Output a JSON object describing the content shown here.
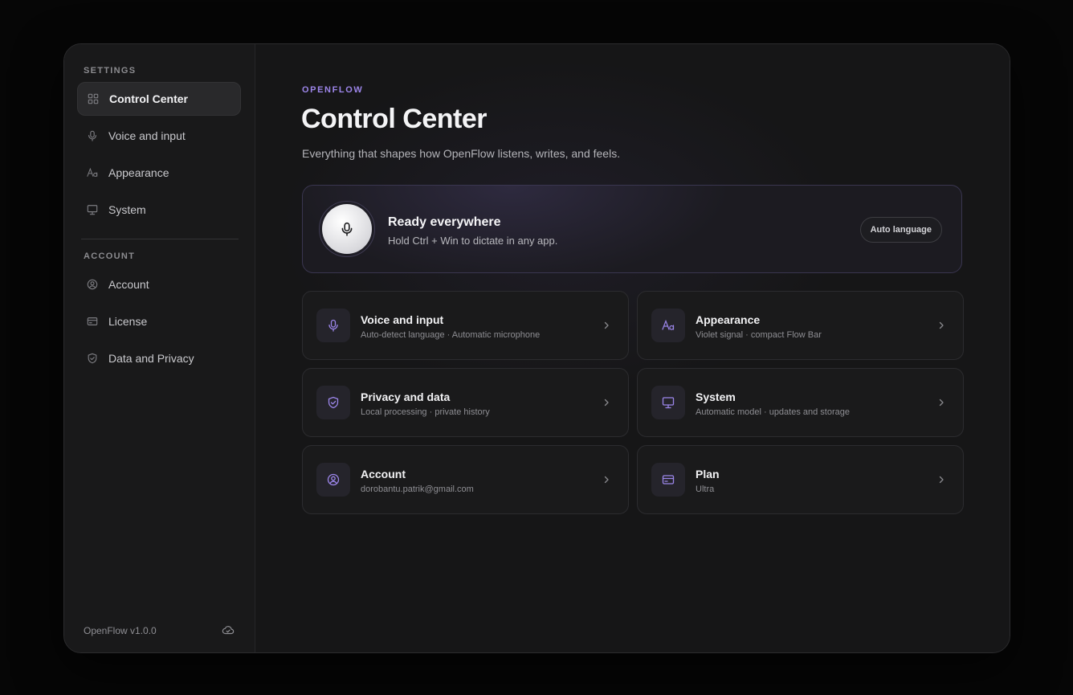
{
  "sidebar": {
    "settings_label": "SETTINGS",
    "settings_items": [
      {
        "label": "Control Center",
        "icon": "grid-icon",
        "active": true
      },
      {
        "label": "Voice and input",
        "icon": "microphone-icon"
      },
      {
        "label": "Appearance",
        "icon": "typography-icon"
      },
      {
        "label": "System",
        "icon": "monitor-icon"
      }
    ],
    "account_label": "ACCOUNT",
    "account_items": [
      {
        "label": "Account",
        "icon": "user-circle-icon"
      },
      {
        "label": "License",
        "icon": "credit-card-icon"
      },
      {
        "label": "Data and Privacy",
        "icon": "shield-check-icon"
      }
    ],
    "version": "OpenFlow v1.0.0",
    "sync_icon": "cloud-check-icon"
  },
  "header": {
    "eyebrow": "OPENFLOW",
    "title": "Control Center",
    "subtitle": "Everything that shapes how OpenFlow listens, writes, and feels."
  },
  "hero": {
    "title": "Ready everywhere",
    "subtitle": "Hold Ctrl + Win to dictate in any app.",
    "chip": "Auto language",
    "icon": "microphone-icon"
  },
  "cards": [
    {
      "title": "Voice and input",
      "subtitle": "Auto-detect language · Automatic microphone",
      "icon": "microphone-icon"
    },
    {
      "title": "Appearance",
      "subtitle": "Violet signal · compact Flow Bar",
      "icon": "typography-icon"
    },
    {
      "title": "Privacy and data",
      "subtitle": "Local processing · private history",
      "icon": "shield-check-icon"
    },
    {
      "title": "System",
      "subtitle": "Automatic model · updates and storage",
      "icon": "monitor-icon"
    },
    {
      "title": "Account",
      "subtitle": "dorobantu.patrik@gmail.com",
      "icon": "user-circle-icon"
    },
    {
      "title": "Plan",
      "subtitle": "Ultra",
      "icon": "credit-card-icon"
    }
  ],
  "colors": {
    "accent": "#9c86ea",
    "background": "#161617",
    "sidebar": "#19191a"
  }
}
